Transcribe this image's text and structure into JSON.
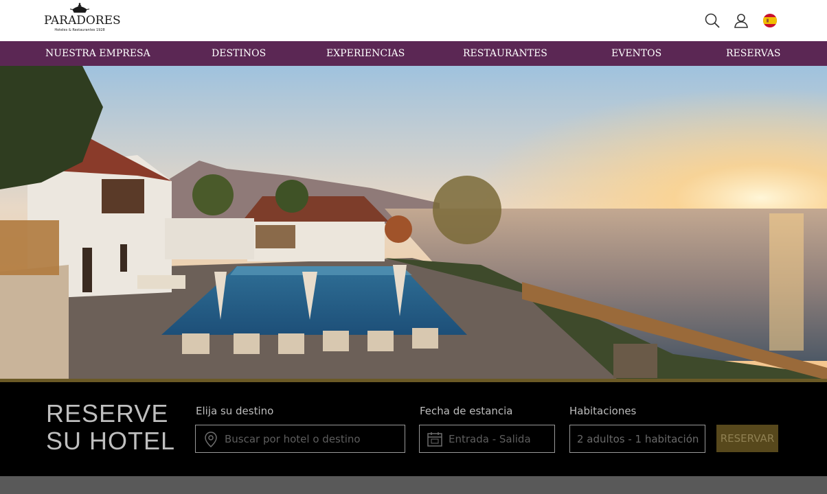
{
  "brand": {
    "name": "PARADORES",
    "tagline": "Hoteles & Restaurantes 1928"
  },
  "header": {
    "icons": [
      "search-icon",
      "user-icon",
      "spain-flag-icon"
    ]
  },
  "nav": {
    "items": [
      {
        "label": "NUESTRA  EMPRESA"
      },
      {
        "label": "DESTINOS"
      },
      {
        "label": "EXPERIENCIAS"
      },
      {
        "label": "RESTAURANTES"
      },
      {
        "label": "EVENTOS"
      },
      {
        "label": "RESERVAS"
      }
    ]
  },
  "booking": {
    "title_line1": "RESERVE",
    "title_line2": "SU HOTEL",
    "destination": {
      "label": "Elija su destino",
      "placeholder": "Buscar por hotel o destino"
    },
    "dates": {
      "label": "Fecha de estancia",
      "placeholder": "Entrada - Salida"
    },
    "rooms": {
      "label": "Habitaciones",
      "value": "2 adultos - 1 habitación"
    },
    "submit_label": "RESERVAR"
  },
  "colors": {
    "nav_bg": "#5b2754",
    "booking_bg": "#000000",
    "accent_gold": "#57481c"
  }
}
